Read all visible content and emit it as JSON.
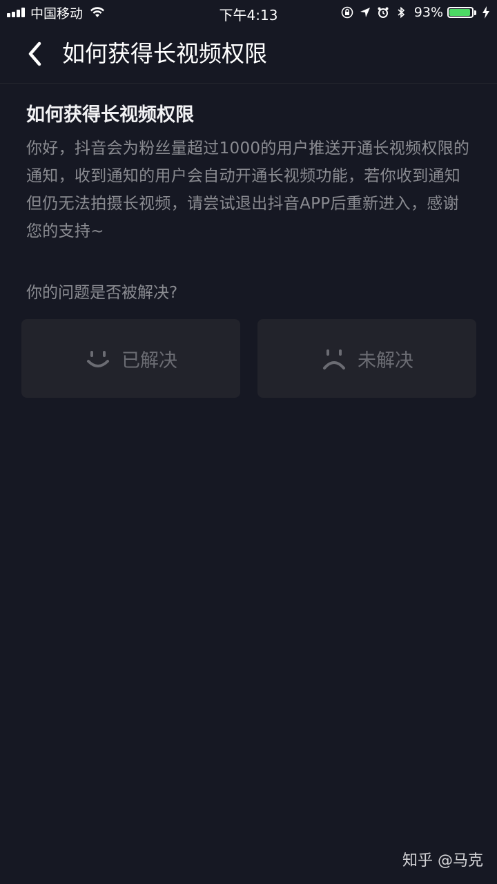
{
  "status_bar": {
    "carrier": "中国移动",
    "time": "下午4:13",
    "battery_percent": "93%",
    "battery_level": 0.93,
    "battery_color": "#4cd964"
  },
  "header": {
    "back_icon": "chevron-left-icon",
    "title": "如何获得长视频权限"
  },
  "article": {
    "title": "如何获得长视频权限",
    "body": "你好，抖音会为粉丝量超过1000的用户推送开通长视频权限的通知，收到通知的用户会自动开通长视频功能，若你收到通知但仍无法拍摄长视频，请尝试退出抖音APP后重新进入，感谢您的支持~"
  },
  "feedback": {
    "question": "你的问题是否被解决?",
    "resolved": {
      "label": "已解决",
      "icon": "smile-icon"
    },
    "unresolved": {
      "label": "未解决",
      "icon": "frown-icon"
    }
  },
  "watermark": "知乎 @马克",
  "colors": {
    "background": "#161823",
    "button_bg": "#22232b",
    "muted_text": "#8a8b91"
  }
}
